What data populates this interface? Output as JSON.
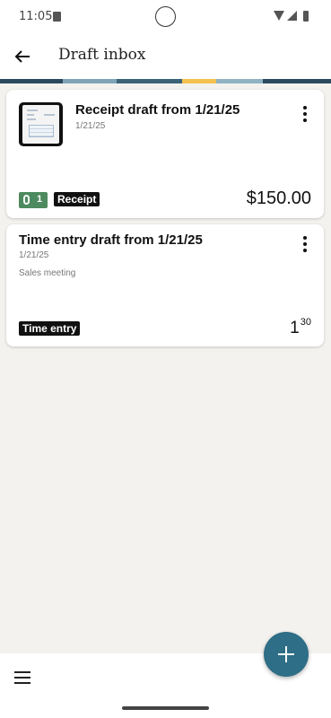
{
  "status_bar": {
    "time": "11:05"
  },
  "app_bar": {
    "title": "Draft inbox"
  },
  "drafts": [
    {
      "title": "Receipt draft from 1/21/25",
      "date": "1/21/25",
      "attachment_count": "1",
      "type_tag": "Receipt",
      "amount": "$150.00"
    },
    {
      "title": "Time entry draft from 1/21/25",
      "date": "1/21/25",
      "note": "Sales meeting",
      "type_tag": "Time entry",
      "duration_hours": "1",
      "duration_minutes": "30"
    }
  ],
  "colors": {
    "fab": "#2e6e86",
    "attachment_badge": "#4d8a5f",
    "deco_strip": [
      "#2c4a5e",
      "#7fa4b5",
      "#3b6478",
      "#f2c14e",
      "#8fb3c2",
      "#2c4a5e"
    ]
  },
  "icons": {
    "back": "arrow-left-icon",
    "more": "more-vert-icon",
    "attachment": "paperclip-icon",
    "menu": "hamburger-menu-icon",
    "add": "plus-icon"
  }
}
